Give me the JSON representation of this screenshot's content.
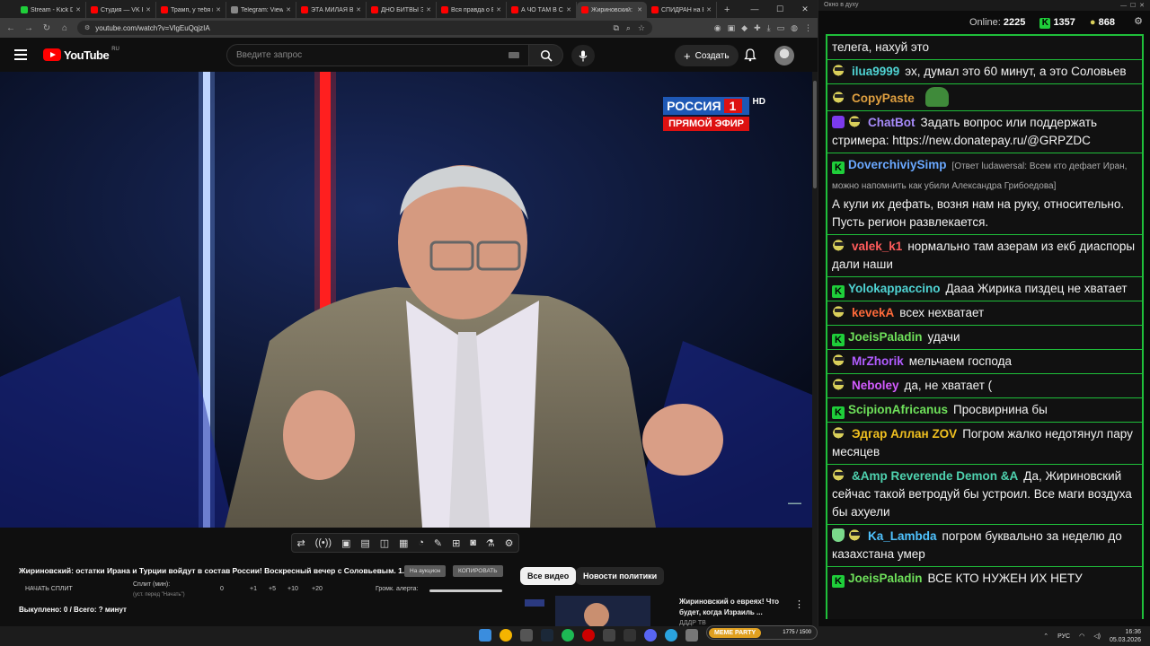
{
  "browser": {
    "tabs": [
      {
        "title": "Stream - Kick D",
        "color": "#1fce3a",
        "active": false
      },
      {
        "title": "Студия — VK В",
        "color": "#ff0000",
        "active": false
      },
      {
        "title": "Трамп, у тебя н",
        "color": "#ff0000",
        "active": false
      },
      {
        "title": "Telegram: View",
        "color": "#888888",
        "active": false
      },
      {
        "title": "ЭТА МИЛАЯ ВЬ",
        "color": "#ff0000",
        "active": false
      },
      {
        "title": "ДНО БИТВЫ ЭК",
        "color": "#ff0000",
        "active": false
      },
      {
        "title": "Вся правда о Е",
        "color": "#ff0000",
        "active": false
      },
      {
        "title": "А ЧО ТАМ В СШ",
        "color": "#ff0000",
        "active": false
      },
      {
        "title": "Жириновский: ",
        "color": "#ff0000",
        "active": true
      },
      {
        "title": "СПИДРАН на В",
        "color": "#ff0000",
        "active": false
      }
    ],
    "new_tab": "+",
    "url": "youtube.com/watch?v=VlgEuQqjzIA"
  },
  "youtube": {
    "logo_text": "YouTube",
    "region": "RU",
    "search_placeholder": "Введите запрос",
    "create_label": "Создать"
  },
  "video_overlay": {
    "channel_name": "РОССИЯ",
    "channel_number": "1",
    "hd": "HD",
    "live_label": "ПРЯМОЙ ЭФИР"
  },
  "below_video": {
    "title": "Жириновский: остатки Ирана и Турции войдут в состав России! Воскресный вечер с Соловьевым. 1...",
    "btn_copy_all": "На аукцион",
    "btn_copy": "КОПИРОВАТЬ",
    "start_split": "НАЧАТЬ СПЛИТ",
    "split_label": "Сплит (мин):",
    "split_hint": "(уст. перед \"Начать\")",
    "split_value": "0",
    "plus1": "+1",
    "plus5": "+5",
    "plus10": "+10",
    "plus20": "+20",
    "volume_label": "Громк. алерта:",
    "bought": "Выкуплено: 0 / Всего: ? минут",
    "chip_all": "Все видео",
    "chip_politics": "Новости политики",
    "rec_title": "Жириновский о евреях! Что будет, когда Израиль ...",
    "rec_channel": "ДДДР ТВ"
  },
  "chat": {
    "window_title": "Окно в духу",
    "online_label": "Online:",
    "online_count": "2225",
    "kick_count": "1357",
    "other_count": "868",
    "messages": [
      {
        "badge": "none",
        "user": "",
        "color": "#ffffff",
        "text": "телега, нахуй это",
        "reply": ""
      },
      {
        "badge": "user",
        "user": "ilua9999",
        "color": "#4fd3d3",
        "text": "эх, думал это 60 минут, а это Соловьев",
        "reply": ""
      },
      {
        "badge": "user",
        "user": "CopyPaste",
        "color": "#e0a040",
        "text": "",
        "reply": "",
        "emote": true
      },
      {
        "badge": "bot",
        "user": "ChatBot",
        "color": "#a78bfa",
        "text": "Задать вопрос или поддержать стримера: https://new.donatepay.ru/@GRPZDC",
        "reply": ""
      },
      {
        "badge": "kick",
        "user": "DoverchiviySimp",
        "color": "#6aa8ff",
        "text": "А кули их дефать, возня нам на руку, относительно. Пусть регион развлекается.",
        "reply": "[Ответ ludawersal: Всем кто дефает Иран, можно напомнить как убили Александра Грибоедова]"
      },
      {
        "badge": "user",
        "user": "valek_k1",
        "color": "#ff5b5b",
        "text": "нормально там азерам из екб диаспоры дали наши",
        "reply": ""
      },
      {
        "badge": "kick",
        "user": "Yolokappaccino",
        "color": "#4fd3d3",
        "text": "Дааа Жирика пиздец не хватает",
        "reply": ""
      },
      {
        "badge": "user",
        "user": "kevekA",
        "color": "#ff6a3a",
        "text": "всех нехватает",
        "reply": ""
      },
      {
        "badge": "kick",
        "user": "JoeisPaladin",
        "color": "#6ee05a",
        "text": "удачи",
        "reply": ""
      },
      {
        "badge": "user",
        "user": "MrZhorik",
        "color": "#b15cff",
        "text": "мельчаем господа",
        "reply": ""
      },
      {
        "badge": "user",
        "user": "Neboley",
        "color": "#d35cff",
        "text": "да, не хватает (",
        "reply": ""
      },
      {
        "badge": "kick",
        "user": "ScipionAfricanus",
        "color": "#6ee05a",
        "text": "Просвирнина бы",
        "reply": ""
      },
      {
        "badge": "user",
        "user": "Эдгар Аллан ZOV",
        "color": "#f0c020",
        "text": "Погром жалко недотянул пару месяцев",
        "reply": ""
      },
      {
        "badge": "user",
        "user": "&Amp Reverende Demon &A",
        "color": "#4fd3b0",
        "text": "Да, Жириновский сейчас такой ветродуй бы устроил. Все маги воздуха бы ахуели",
        "reply": ""
      },
      {
        "badge": "shield",
        "user": "Ka_Lambda",
        "color": "#4fc3ff",
        "text": "погром буквально за неделю до казахстана умер",
        "reply": ""
      },
      {
        "badge": "kick",
        "user": "JoeisPaladin",
        "color": "#6ee05a",
        "text": "ВСЕ КТО НУЖЕН ИХ НЕТУ",
        "reply": ""
      }
    ]
  },
  "taskbar": {
    "lang": "РУС",
    "time": "16:36",
    "date": "05.03.2026",
    "meme_label": "MEME PARTY",
    "meme_value": "1775 / 1500"
  }
}
